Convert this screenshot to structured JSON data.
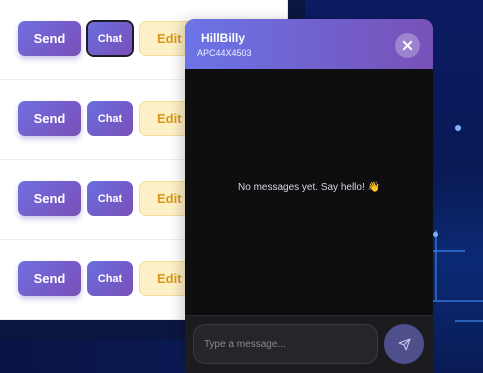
{
  "rows": [
    {
      "send_label": "Send",
      "chat_label": "Chat",
      "edit_label": "Edit"
    },
    {
      "send_label": "Send",
      "chat_label": "Chat",
      "edit_label": "Edit"
    },
    {
      "send_label": "Send",
      "chat_label": "Chat",
      "edit_label": "Edit"
    },
    {
      "send_label": "Send",
      "chat_label": "Chat",
      "edit_label": "Edit"
    }
  ],
  "chat": {
    "name": "HillBilly",
    "id": "APC44X4503",
    "empty_message": "No messages yet. Say hello! 👋",
    "input_value": "",
    "input_placeholder": "Type a message...",
    "close_icon": "close-icon",
    "send_icon": "paper-plane-icon"
  },
  "colors": {
    "primary_gradient_start": "#6f6fe0",
    "primary_gradient_end": "#7a4fb7",
    "edit_bg": "#fdefc6",
    "edit_text": "#d49a1a",
    "chat_bg": "#0e0e10"
  }
}
